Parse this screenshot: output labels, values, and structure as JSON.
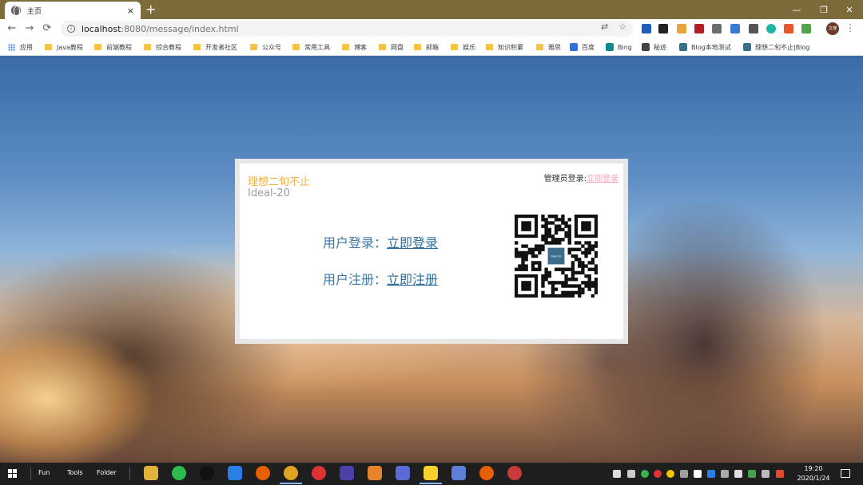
{
  "browser": {
    "tab_title": "主页",
    "tab_close": "×",
    "new_tab": "+",
    "window": {
      "minimize": "—",
      "maximize": "❐",
      "close": "✕"
    },
    "nav": {
      "back": "←",
      "forward": "→",
      "reload": "⟳"
    },
    "url_host": "localhost",
    "url_rest": ":8080/message/index.html",
    "profile_label": "文博",
    "menu": "⋮"
  },
  "bookmarks": [
    {
      "label": "应用",
      "type": "apps"
    },
    {
      "label": "Java教程",
      "type": "folder"
    },
    {
      "label": "前端教程",
      "type": "folder"
    },
    {
      "label": "综合教程",
      "type": "folder"
    },
    {
      "label": "开发者社区",
      "type": "folder"
    },
    {
      "label": "公众号",
      "type": "folder"
    },
    {
      "label": "常用工具",
      "type": "folder"
    },
    {
      "label": "博客",
      "type": "folder"
    },
    {
      "label": "网盘",
      "type": "folder"
    },
    {
      "label": "邮箱",
      "type": "folder"
    },
    {
      "label": "娱乐",
      "type": "folder"
    },
    {
      "label": "知识积累",
      "type": "folder"
    },
    {
      "label": "雅思",
      "type": "folder"
    },
    {
      "label": "百度",
      "type": "site",
      "color": "#2f6fe0"
    },
    {
      "label": "Bing",
      "type": "site",
      "color": "#0b8b8b"
    },
    {
      "label": "秘迹",
      "type": "site",
      "color": "#444444"
    },
    {
      "label": "Blog本地测试",
      "type": "site",
      "color": "#3b6d8c"
    },
    {
      "label": "理想二旬不止|Blog",
      "type": "site",
      "color": "#3b6d8c"
    }
  ],
  "card": {
    "brand": "理想二旬不止",
    "brand_sub": "Ideal-20",
    "admin_label": "管理员登录:",
    "admin_link": "立即登录",
    "login_label": "用户登录：",
    "login_link": "立即登录",
    "register_label": "用户注册：",
    "register_link": "立即注册",
    "qr_center": "Ideal-20"
  },
  "taskbar": {
    "items": [
      "Fun",
      "Tools",
      "Folder"
    ],
    "time": "19:20",
    "date": "2020/1/24"
  },
  "colors": {
    "brand": "#f2b03c",
    "link": "#2f6c9c",
    "admin_link": "#f5a7b8",
    "tab_strip": "#7d6c3a"
  }
}
